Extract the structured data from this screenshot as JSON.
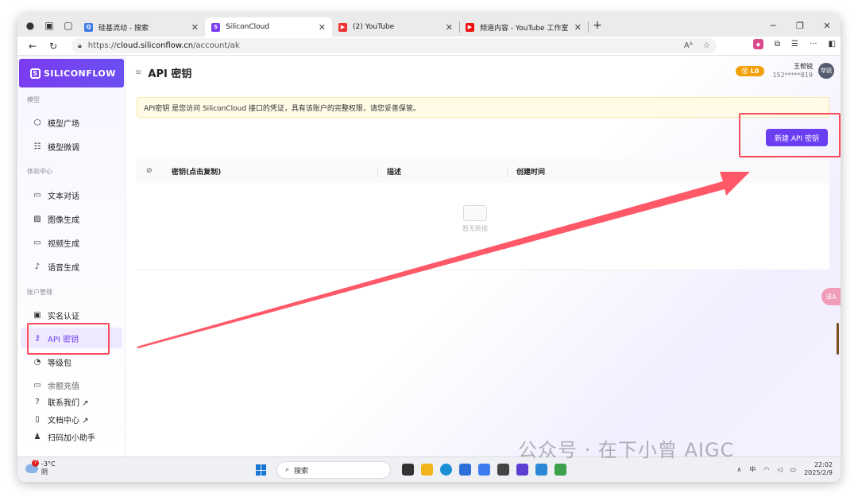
{
  "browser": {
    "tabs": [
      {
        "label": "硅基流动 - 搜索"
      },
      {
        "label": "SiliconCloud"
      },
      {
        "label": "(2) YouTube"
      },
      {
        "label": "频道内容 - YouTube 工作室"
      }
    ],
    "new_tab": "+",
    "url_prefix": "https://",
    "url_domain": "cloud.siliconflow.cn",
    "url_path": "/account/ak"
  },
  "sidebar": {
    "logo_text": "SILICONFLOW",
    "sections": {
      "model": "模型",
      "experience": "体验中心",
      "account": "账户管理"
    },
    "items": {
      "model_square": "模型广场",
      "model_finetune": "模型微调",
      "text_chat": "文本对话",
      "image_gen": "图像生成",
      "video_gen": "视频生成",
      "voice_gen": "语音生成",
      "realname": "实名认证",
      "api_key": "API 密钥",
      "level_pack": "等级包",
      "balance": "余额充值",
      "contact": "联系我们 ↗",
      "docs": "文档中心 ↗",
      "assistant": "扫码加小助手"
    }
  },
  "header": {
    "title": "API 密钥",
    "vip_level": "L0",
    "user_name": "王帮锐",
    "user_phone": "152*****819",
    "avatar_text": "帮锐"
  },
  "notice": "API密钥 是您访问 SiliconCloud 接口的凭证，具有该账户的完整权限，请您妥善保管。",
  "new_key_button": "新建 API 密钥",
  "table": {
    "columns": [
      "密钥(点击复制)",
      "描述",
      "创建时间"
    ],
    "empty_text": "暂无数据"
  },
  "translate_label": "译A",
  "taskbar": {
    "temperature": "-3°C",
    "weather": "阴",
    "weather_badge": "7",
    "search_placeholder": "搜索",
    "ime": "中",
    "time": "22:02",
    "date": "2025/2/9"
  },
  "watermark": "公众号 · 在下小曾 AIGC",
  "colors": {
    "accent": "#6c3ef2",
    "annotation": "#ff4b5c",
    "notice_bg": "#fffbe6"
  }
}
